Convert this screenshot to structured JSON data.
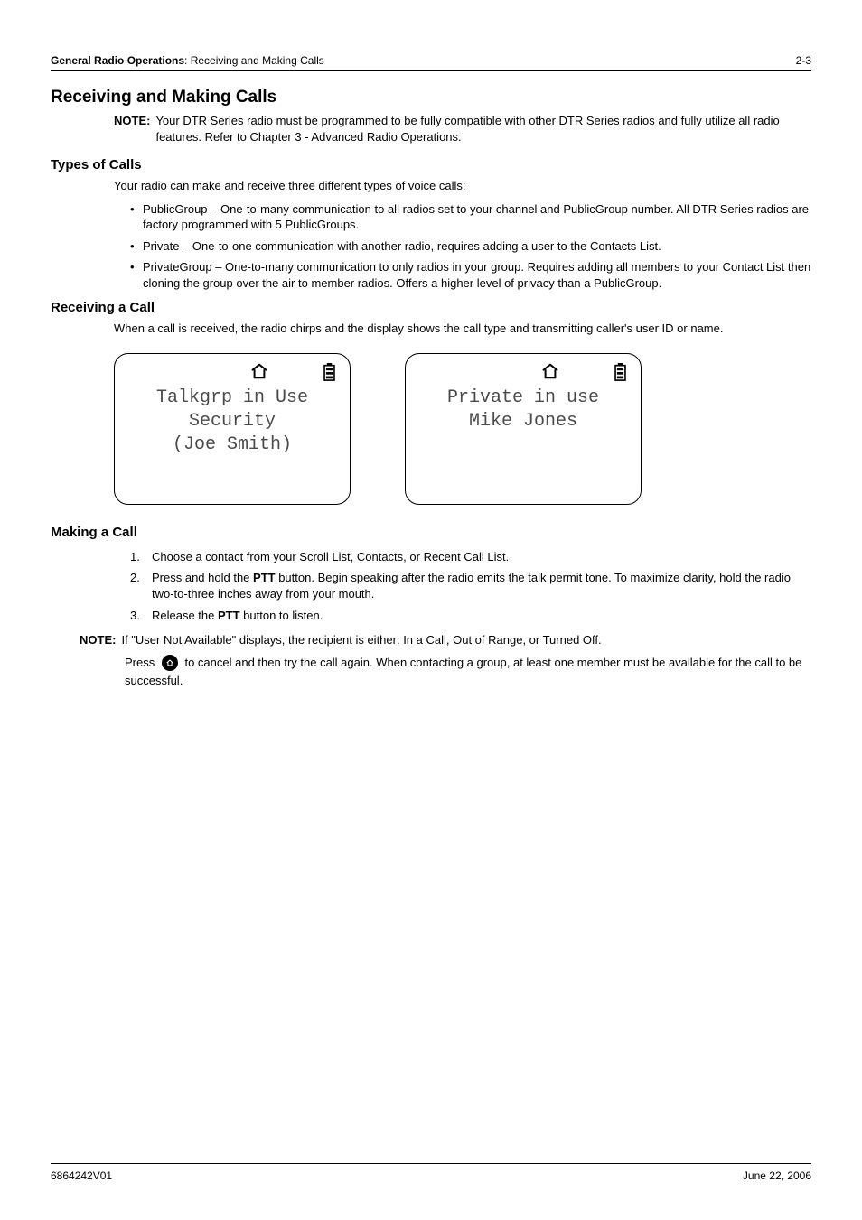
{
  "header": {
    "section_bold": "General Radio Operations",
    "section_rest": ": Receiving and Making Calls",
    "page_number": "2-3"
  },
  "title": "Receiving and Making Calls",
  "note_top": {
    "label": "NOTE:",
    "body": "Your DTR Series radio must be programmed to be fully compatible with other DTR Series radios and fully utilize all radio features. Refer to Chapter 3 - Advanced Radio Operations."
  },
  "types_of_calls": {
    "heading": "Types of Calls",
    "intro": "Your radio can make and receive three different types of voice calls:",
    "items": [
      "PublicGroup – One-to-many communication to all radios set to your channel and PublicGroup number. All DTR Series radios are factory programmed with 5 PublicGroups.",
      "Private – One-to-one communication with another radio, requires adding a user to the Contacts List.",
      "PrivateGroup – One-to-many communication to only radios in your group. Requires adding all members to your Contact List then cloning the group over the air to member radios. Offers a higher level of privacy than a PublicGroup."
    ]
  },
  "receiving": {
    "heading": "Receiving a Call",
    "body": "When a call is received, the radio chirps and the display shows the call type and transmitting caller's user ID or name."
  },
  "screens": [
    {
      "lines": [
        "Talkgrp in Use",
        "Security",
        "(Joe Smith)"
      ]
    },
    {
      "lines": [
        "Private in use",
        "Mike Jones",
        ""
      ]
    }
  ],
  "making": {
    "heading": "Making a Call",
    "steps": [
      {
        "num": "1.",
        "text_before": "Choose a contact from your Scroll List, Contacts, or Recent Call List."
      },
      {
        "num": "2.",
        "text_before": "Press and hold the ",
        "bold": "PTT",
        "text_after": " button. Begin speaking after the radio emits the talk permit tone. To maximize clarity, hold the radio two-to-three inches away from your mouth."
      },
      {
        "num": "3.",
        "text_before": "Release the ",
        "bold": "PTT",
        "text_after": " button to listen."
      }
    ]
  },
  "note_bottom": {
    "label": "NOTE:",
    "line1": "If \"User Not Available\" displays, the recipient is either: In a Call, Out of Range, or Turned Off.",
    "line2_a": "Press ",
    "line2_b": " to cancel and then try the call again. When contacting a group, at least one member must be available for the call to be successful."
  },
  "footer": {
    "left": "6864242V01",
    "right": "June 22, 2006"
  },
  "icons": {
    "home": "home-icon",
    "battery": "battery-icon",
    "home_button": "home-button-icon"
  }
}
